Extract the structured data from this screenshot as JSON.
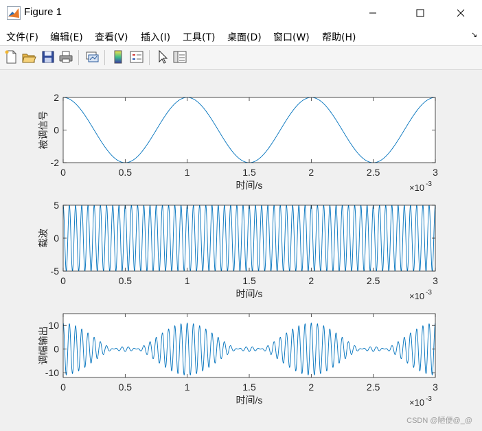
{
  "window": {
    "title": "Figure 1",
    "minimize_glyph": "—",
    "maximize_glyph": "☐",
    "close_glyph": "✕"
  },
  "menu": {
    "items": [
      "文件(F)",
      "编辑(E)",
      "查看(V)",
      "插入(I)",
      "工具(T)",
      "桌面(D)",
      "窗口(W)",
      "帮助(H)"
    ],
    "overflow_glyph": "↘"
  },
  "toolbar": {
    "icons": [
      "new-figure-icon",
      "open-file-icon",
      "save-icon",
      "print-icon",
      "link-plot-icon",
      "insert-colorbar-icon",
      "insert-legend-icon",
      "edit-plot-arrow-icon",
      "property-inspector-icon"
    ]
  },
  "colors": {
    "line": "#0072bd",
    "axes": "#262626",
    "background": "#f0f0f0",
    "plot_bg": "#ffffff"
  },
  "chart_data": [
    {
      "type": "line",
      "name": "modulating",
      "ylabel": "被调信号",
      "xlabel": "时间/s",
      "x_exponent": "×10",
      "x_exponent_power": "-3",
      "xlim": [
        0,
        0.003
      ],
      "ylim": [
        -2,
        2
      ],
      "xticks": [
        "0",
        "0.5",
        "1",
        "1.5",
        "2",
        "2.5",
        "3"
      ],
      "yticks": [
        "-2",
        "0",
        "2"
      ],
      "signal": "y = 2*cos(2*pi*1000*t)",
      "amplitude": 2,
      "frequency_hz": 1000,
      "grid": false
    },
    {
      "type": "line",
      "name": "carrier",
      "ylabel": "载波",
      "xlabel": "时间/s",
      "x_exponent": "×10",
      "x_exponent_power": "-3",
      "xlim": [
        0,
        0.003
      ],
      "ylim": [
        -5,
        5
      ],
      "xticks": [
        "0",
        "0.5",
        "1",
        "1.5",
        "2",
        "2.5",
        "3"
      ],
      "yticks": [
        "-5",
        "0",
        "5"
      ],
      "signal": "y = 5*cos(2*pi*20000*t)",
      "amplitude": 5,
      "frequency_hz": 20000,
      "grid": false
    },
    {
      "type": "line",
      "name": "am-output",
      "ylabel": "调幅输出",
      "xlabel": "时间/s",
      "x_exponent": "×10",
      "x_exponent_power": "-3",
      "xlim": [
        0,
        0.003
      ],
      "ylim": [
        -12,
        15
      ],
      "xticks": [
        "0",
        "0.5",
        "1",
        "1.5",
        "2",
        "2.5",
        "3"
      ],
      "yticks": [
        "-10",
        "0",
        "10"
      ],
      "signal": "y = (5 + 3*2*cos(2*pi*1000*t))*cos(2*pi*20000*t)",
      "dc_offset": 5,
      "modulation_gain": 3,
      "carrier_hz": 20000,
      "message_hz": 1000,
      "message_amplitude": 2,
      "grid": false
    }
  ],
  "watermark": "CSDN @陋便@_@"
}
